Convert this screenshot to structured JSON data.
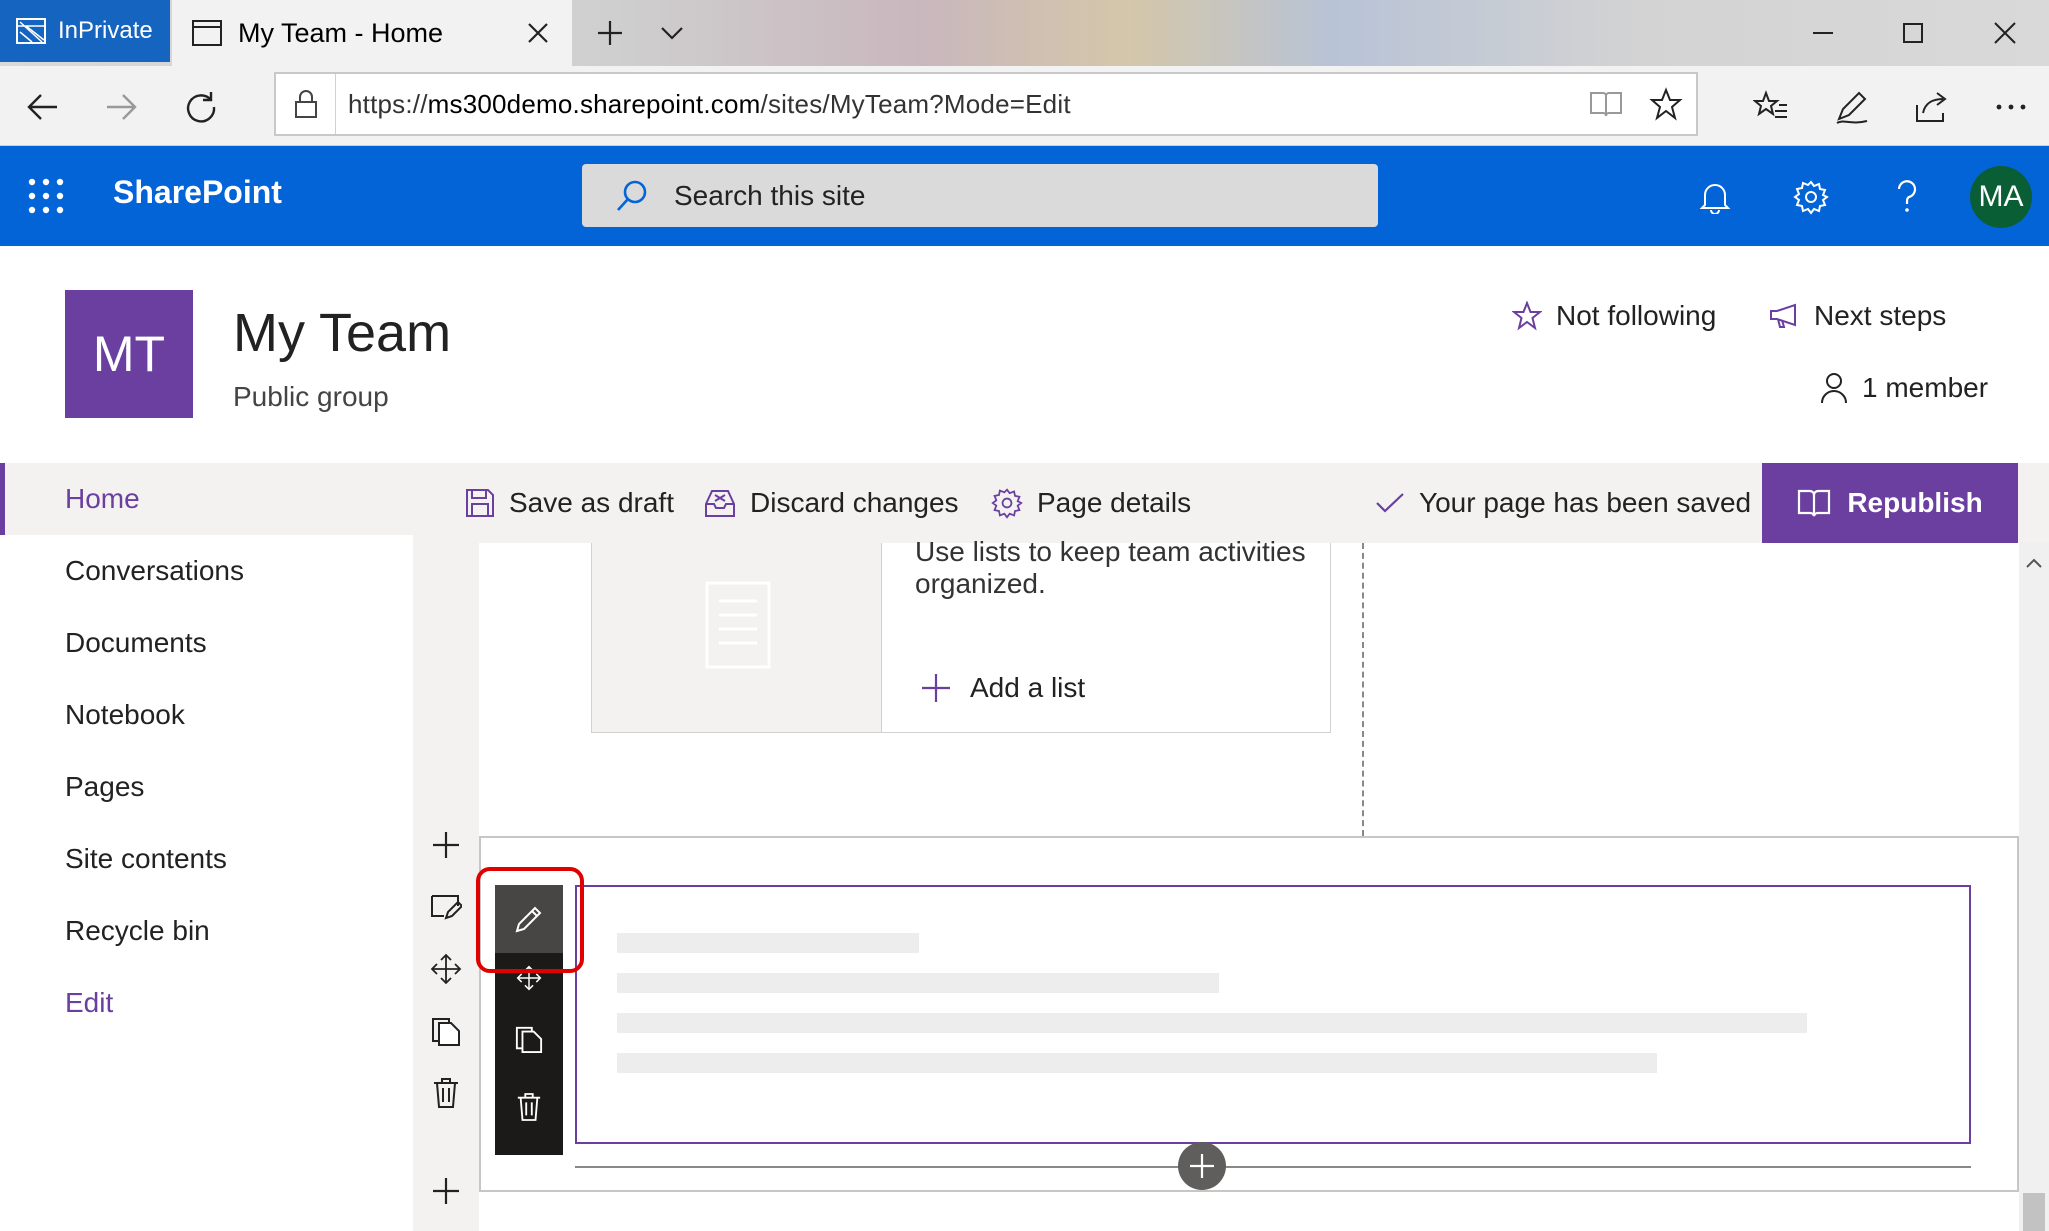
{
  "browser": {
    "inprivate_label": "InPrivate",
    "tab_title": "My Team - Home",
    "url_prefix": "https://",
    "url_host": "ms300demo.sharepoint.com",
    "url_path": "/sites/MyTeam?Mode=Edit"
  },
  "suite": {
    "brand": "SharePoint",
    "search_placeholder": "Search this site",
    "avatar_initials": "MA"
  },
  "site": {
    "logo_initials": "MT",
    "title": "My Team",
    "subtitle": "Public group",
    "follow_label": "Not following",
    "next_steps_label": "Next steps",
    "members_label": "1 member"
  },
  "nav": {
    "items": [
      {
        "label": "Home"
      },
      {
        "label": "Conversations"
      },
      {
        "label": "Documents"
      },
      {
        "label": "Notebook"
      },
      {
        "label": "Pages"
      },
      {
        "label": "Site contents"
      },
      {
        "label": "Recycle bin"
      }
    ],
    "edit_label": "Edit"
  },
  "commands": {
    "save_draft": "Save as draft",
    "discard": "Discard changes",
    "page_details": "Page details",
    "saved_status": "Your page has been saved",
    "republish": "Republish"
  },
  "canvas": {
    "list_description": "Use lists to keep team activities organized.",
    "add_list": "Add a list"
  },
  "colors": {
    "suite_bar": "#0364d8",
    "accent": "#6b3fa0",
    "highlight": "#e00000",
    "avatar": "#0a5e36"
  }
}
